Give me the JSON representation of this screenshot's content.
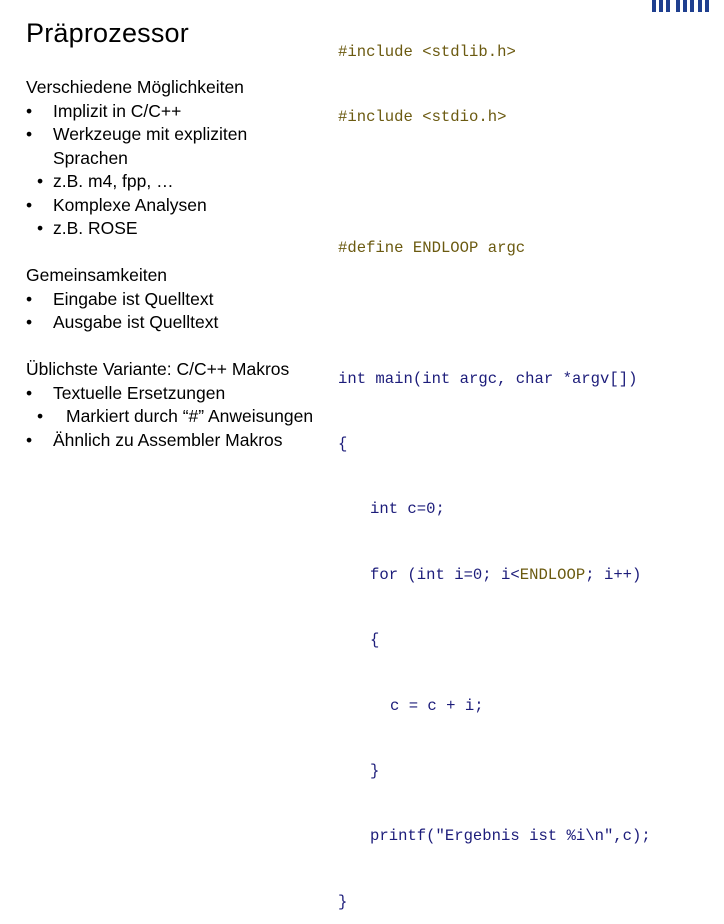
{
  "slide": {
    "title": "Präprozessor"
  },
  "left": {
    "section1_heading": "Verschiedene Möglichkeiten",
    "section1_items": [
      {
        "level": 1,
        "text": "Implizit in C/C++"
      },
      {
        "level": 1,
        "text": "Werkzeuge mit expliziten"
      },
      {
        "level": 0,
        "text": "Sprachen"
      },
      {
        "level": 2,
        "text": "z.B. m4, fpp, …"
      },
      {
        "level": 1,
        "text": "Komplexe Analysen"
      },
      {
        "level": 2,
        "text": "z.B. ROSE"
      }
    ],
    "section2_heading": "Gemeinsamkeiten",
    "section2_items": [
      {
        "level": 1,
        "text": "Eingabe ist Quelltext"
      },
      {
        "level": 1,
        "text": "Ausgabe ist Quelltext"
      }
    ],
    "section3_heading": "Üblichste Variante: C/C++ Makros",
    "section3_items": [
      {
        "level": 1,
        "text": "Textuelle Ersetzungen"
      },
      {
        "level": 2,
        "text": "Markiert durch “#” Anweisungen"
      },
      {
        "level": 1,
        "text": "Ähnlich zu Assembler Makros"
      }
    ],
    "bullet_glyph": "•"
  },
  "code": {
    "line1": "#include <stdlib.h>",
    "line2": "#include <stdio.h>",
    "line3": "",
    "line4_kw": "#define ",
    "line4_val": "ENDLOOP argc",
    "line5": "",
    "line6": "int main(int argc, char *argv[])",
    "line7": "{",
    "line8": "int c=0;",
    "line9_a": "for (int i=0; i<",
    "line9_b": "ENDLOOP",
    "line9_c": "; i++)",
    "line10": "{",
    "line11": "c = c + i;",
    "line12": "}",
    "line13": "printf(\"Ergebnis ist %i\\n\",c);",
    "line14": "}"
  },
  "colors": {
    "code_text": "#1c1c7a",
    "preprocessor_text": "#6b5a10",
    "logo": "#1f3f8f"
  },
  "logo": {
    "icon": "tum-logo-icon"
  }
}
